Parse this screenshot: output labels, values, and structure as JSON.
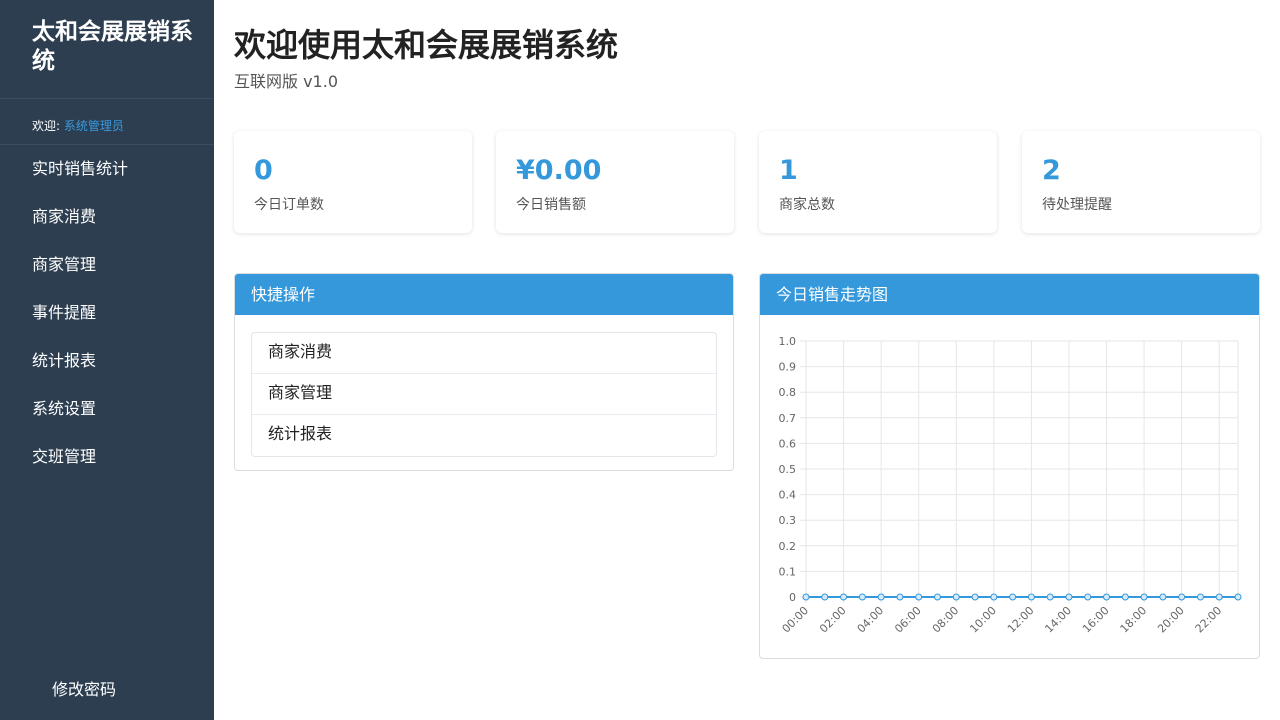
{
  "sidebar": {
    "brand": "太和会展展销系统",
    "welcome_label": "欢迎:",
    "welcome_user": "系统管理员",
    "items": [
      {
        "label": "实时销售统计"
      },
      {
        "label": "商家消费"
      },
      {
        "label": "商家管理"
      },
      {
        "label": "事件提醒"
      },
      {
        "label": "统计报表"
      },
      {
        "label": "系统设置"
      },
      {
        "label": "交班管理"
      }
    ],
    "change_password": "修改密码"
  },
  "header": {
    "title": "欢迎使用太和会展展销系统",
    "subtitle": "互联网版 v1.0"
  },
  "stats": [
    {
      "value": "0",
      "label": "今日订单数"
    },
    {
      "value": "¥0.00",
      "label": "今日销售额"
    },
    {
      "value": "1",
      "label": "商家总数"
    },
    {
      "value": "2",
      "label": "待处理提醒"
    }
  ],
  "quick_actions": {
    "title": "快捷操作",
    "items": [
      {
        "label": "商家消费"
      },
      {
        "label": "商家管理"
      },
      {
        "label": "统计报表"
      }
    ]
  },
  "chart_panel": {
    "title": "今日销售走势图"
  },
  "chart_data": {
    "type": "line",
    "x": [
      "00:00",
      "01:00",
      "02:00",
      "03:00",
      "04:00",
      "05:00",
      "06:00",
      "07:00",
      "08:00",
      "09:00",
      "10:00",
      "11:00",
      "12:00",
      "13:00",
      "14:00",
      "15:00",
      "16:00",
      "17:00",
      "18:00",
      "19:00",
      "20:00",
      "21:00",
      "22:00",
      "23:00"
    ],
    "x_tick_labels": [
      "00:00",
      "02:00",
      "04:00",
      "06:00",
      "08:00",
      "10:00",
      "12:00",
      "14:00",
      "16:00",
      "18:00",
      "20:00",
      "22:00"
    ],
    "series": [
      {
        "values": [
          0,
          0,
          0,
          0,
          0,
          0,
          0,
          0,
          0,
          0,
          0,
          0,
          0,
          0,
          0,
          0,
          0,
          0,
          0,
          0,
          0,
          0,
          0,
          0
        ]
      }
    ],
    "y_ticks": [
      "0",
      "0.1",
      "0.2",
      "0.3",
      "0.4",
      "0.5",
      "0.6",
      "0.7",
      "0.8",
      "0.9",
      "1.0"
    ],
    "ylim": [
      0,
      1
    ],
    "grid": true,
    "line_color": "#3498db"
  },
  "colors": {
    "sidebar_bg": "#2c3e50",
    "accent": "#3498db"
  }
}
